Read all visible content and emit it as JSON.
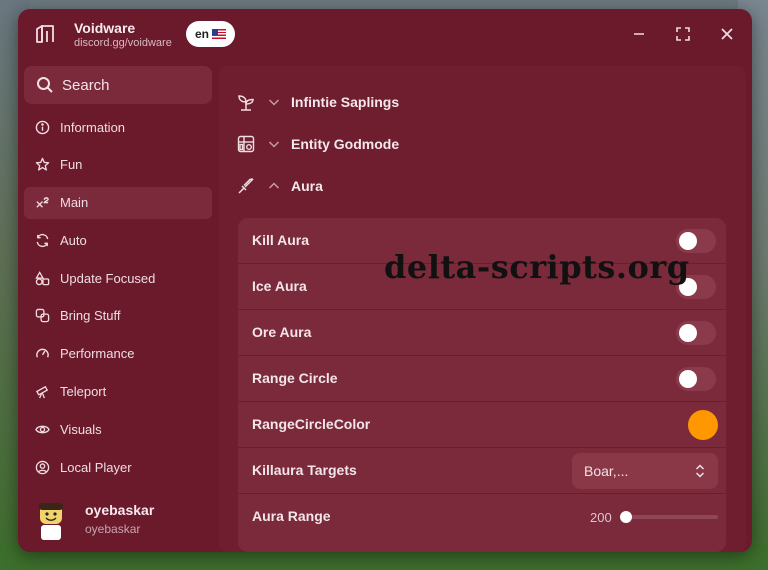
{
  "window": {
    "title": "Voidware",
    "subtitle": "discord.gg/voidware",
    "language_label": "en",
    "language_flag": "us-flag-icon",
    "controls": [
      "minimize-icon",
      "maximize-icon",
      "close-icon"
    ]
  },
  "sidebar": {
    "search_label": "Search",
    "items": [
      {
        "label": "Information",
        "icon": "info-icon",
        "active": false
      },
      {
        "label": "Fun",
        "icon": "star-icon",
        "active": false
      },
      {
        "label": "Main",
        "icon": "superscript-icon",
        "active": true
      },
      {
        "label": "Auto",
        "icon": "refresh-icon",
        "active": false
      },
      {
        "label": "Update Focused",
        "icon": "shapes-icon",
        "active": false
      },
      {
        "label": "Bring Stuff",
        "icon": "link-icon",
        "active": false
      },
      {
        "label": "Performance",
        "icon": "gauge-icon",
        "active": false
      },
      {
        "label": "Teleport",
        "icon": "telescope-icon",
        "active": false
      },
      {
        "label": "Visuals",
        "icon": "eye-icon",
        "active": false
      },
      {
        "label": "Local Player",
        "icon": "user-circle-icon",
        "active": false
      }
    ],
    "user": {
      "name": "oyebaskar",
      "handle": "oyebaskar"
    }
  },
  "main": {
    "sections": [
      {
        "label": "Infintie Saplings",
        "icon": "sprout-icon",
        "expanded": false
      },
      {
        "label": "Entity Godmode",
        "icon": "grid-icon",
        "expanded": false
      },
      {
        "label": "Aura",
        "icon": "sword-icon",
        "expanded": true
      }
    ],
    "aura": {
      "kill_aura": {
        "label": "Kill Aura",
        "on": false
      },
      "ice_aura": {
        "label": "Ice Aura",
        "on": false
      },
      "ore_aura": {
        "label": "Ore Aura",
        "on": false
      },
      "range_circle": {
        "label": "Range Circle",
        "on": false
      },
      "range_circle_color": {
        "label": "RangeCircleColor",
        "color": "#ff9800"
      },
      "killaura_targets": {
        "label": "Killaura Targets",
        "value": "Boar,..."
      },
      "aura_range": {
        "label": "Aura Range",
        "value": "200",
        "fraction": 0.0
      }
    }
  },
  "watermark": "delta-scripts.org",
  "colors": {
    "window_bg": "#6b1a2c",
    "panel_bg": "#7a2a3a",
    "accent": "#ff9800"
  }
}
